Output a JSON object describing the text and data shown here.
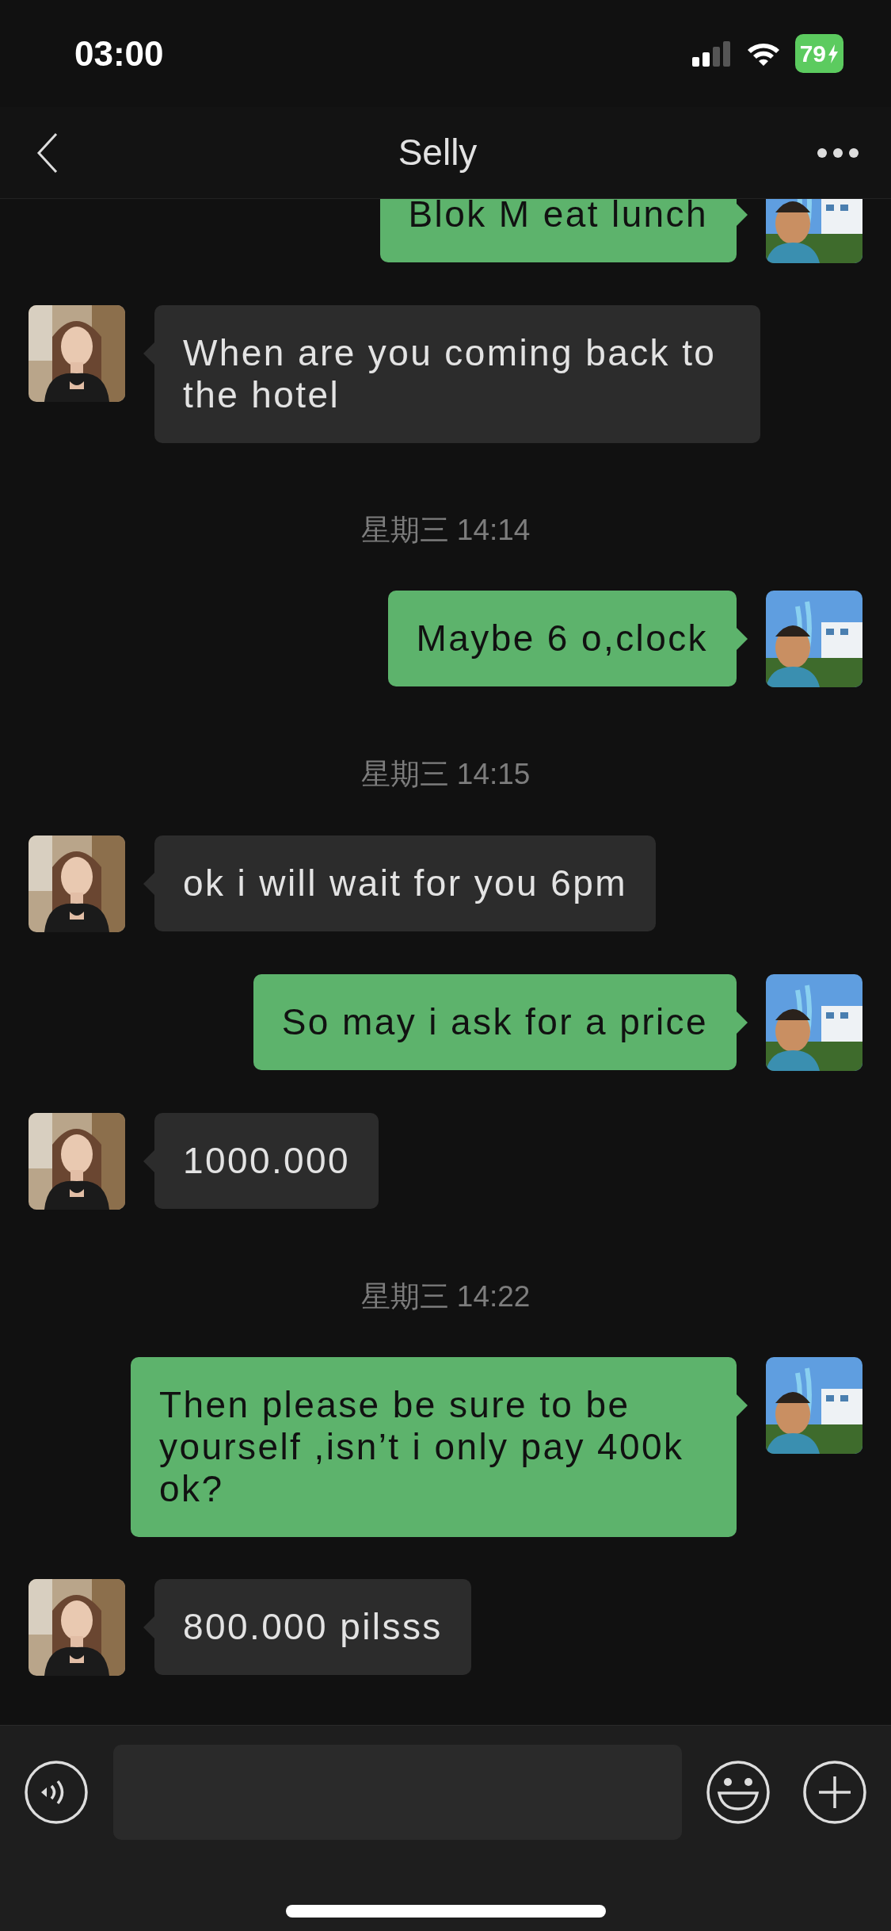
{
  "status_bar": {
    "time": "03:00",
    "battery": "79"
  },
  "header": {
    "title": "Selly"
  },
  "messages": [
    {
      "kind": "outgoing",
      "text": "Blok M eat lunch"
    },
    {
      "kind": "incoming",
      "text": "When are you coming back to the hotel"
    },
    {
      "kind": "time",
      "text": "星期三 14:14"
    },
    {
      "kind": "outgoing",
      "text": "Maybe 6 o,clock"
    },
    {
      "kind": "time",
      "text": "星期三 14:15"
    },
    {
      "kind": "incoming",
      "text": "ok i will wait for you 6pm"
    },
    {
      "kind": "outgoing",
      "text": "So may i ask for a price"
    },
    {
      "kind": "incoming",
      "text": "1000.000"
    },
    {
      "kind": "time",
      "text": "星期三 14:22"
    },
    {
      "kind": "outgoing",
      "text": "Then please be sure to be yourself ,isn’t i only pay 400k ok?"
    },
    {
      "kind": "incoming",
      "text": "800.000 pilsss"
    }
  ]
}
